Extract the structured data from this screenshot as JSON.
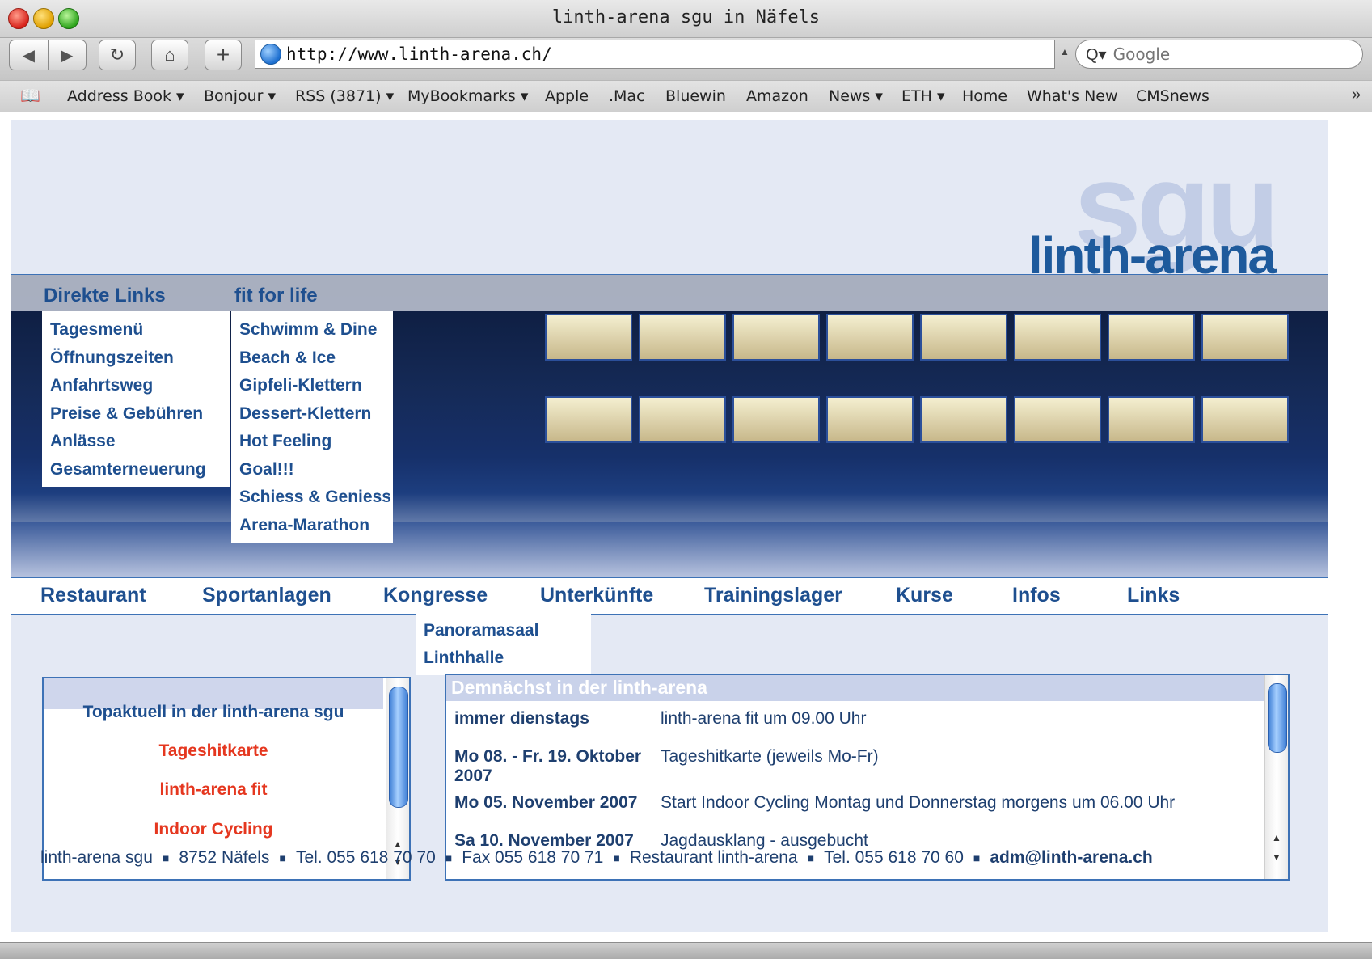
{
  "window": {
    "title": "linth-arena sgu in Näfels"
  },
  "toolbar": {
    "url": "http://www.linth-arena.ch/",
    "search_placeholder": "Google"
  },
  "bookmarks": [
    "Address Book ▾",
    "Bonjour ▾",
    "RSS (3871) ▾",
    "MyBookmarks ▾",
    "Apple",
    ".Mac",
    "Bluewin",
    "Amazon",
    "News ▾",
    "ETH ▾",
    "Home",
    "What's New",
    "CMSnews"
  ],
  "logo": {
    "sgu": "sgu",
    "name": "linth-arena"
  },
  "direkte_links": {
    "title": "Direkte Links",
    "items": [
      "Tagesmenü",
      "Öffnungszeiten",
      "Anfahrtsweg",
      "Preise & Gebühren",
      "Anlässe",
      "Gesamterneuerung"
    ]
  },
  "fit_for_life": {
    "title": "fit for life",
    "items": [
      "Schwimm & Dine",
      "Beach & Ice",
      "Gipfeli-Klettern",
      "Dessert-Klettern",
      "Hot Feeling",
      "Goal!!!",
      "Schiess & Geniess",
      "Arena-Marathon"
    ]
  },
  "main_nav": [
    "Restaurant",
    "Sportanlagen",
    "Kongresse",
    "Unterkünfte",
    "Trainingslager",
    "Kurse",
    "Infos",
    "Links"
  ],
  "kongresse_sub": [
    "Panoramasaal",
    "Linthhalle"
  ],
  "topaktuell": {
    "title": "Topaktuell in der linth-arena sgu",
    "links": [
      "Tageshitkarte",
      "linth-arena fit",
      "Indoor Cycling"
    ]
  },
  "events": {
    "title": "Demnächst in der linth-arena",
    "rows": [
      {
        "date": "immer dienstags",
        "text": "linth-arena fit um 09.00 Uhr"
      },
      {
        "date": "Mo 08. - Fr. 19. Oktober 2007",
        "text": "Tageshitkarte (jeweils Mo-Fr)"
      },
      {
        "date": "Mo 05. November 2007",
        "text": "Start Indoor Cycling Montag und Donnerstag morgens um 06.00 Uhr"
      },
      {
        "date": "Sa 10. November 2007",
        "text": "Jagdausklang - ausgebucht"
      }
    ]
  },
  "footer": {
    "name": "linth-arena sgu",
    "place": "8752 Näfels",
    "tel": "Tel. 055 618 70 70",
    "fax": "Fax 055 618 70 71",
    "restaurant": "Restaurant linth-arena",
    "restaurant_tel": "Tel. 055 618 70 60",
    "email": "adm@linth-arena.ch"
  }
}
